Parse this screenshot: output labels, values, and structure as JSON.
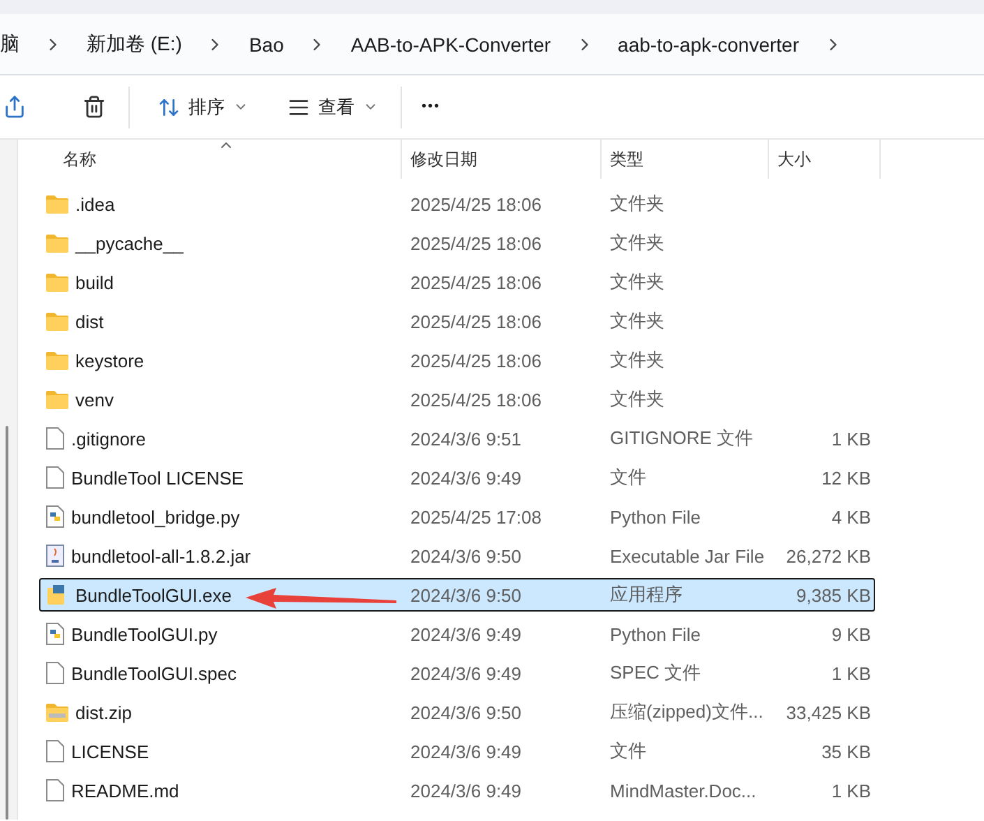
{
  "breadcrumbs": [
    "脑",
    "新加卷 (E:)",
    "Bao",
    "AAB-to-APK-Converter",
    "aab-to-apk-converter"
  ],
  "toolbar": {
    "sort": "排序",
    "view": "查看",
    "more": "•••"
  },
  "columns": [
    "名称",
    "修改日期",
    "类型",
    "大小"
  ],
  "rows": [
    {
      "kind": "folder",
      "name": ".idea",
      "date": "2025/4/25 18:06",
      "type": "文件夹",
      "size": "",
      "selected": false
    },
    {
      "kind": "folder",
      "name": "__pycache__",
      "date": "2025/4/25 18:06",
      "type": "文件夹",
      "size": "",
      "selected": false
    },
    {
      "kind": "folder",
      "name": "build",
      "date": "2025/4/25 18:06",
      "type": "文件夹",
      "size": "",
      "selected": false
    },
    {
      "kind": "folder",
      "name": "dist",
      "date": "2025/4/25 18:06",
      "type": "文件夹",
      "size": "",
      "selected": false
    },
    {
      "kind": "folder",
      "name": "keystore",
      "date": "2025/4/25 18:06",
      "type": "文件夹",
      "size": "",
      "selected": false
    },
    {
      "kind": "folder",
      "name": "venv",
      "date": "2025/4/25 18:06",
      "type": "文件夹",
      "size": "",
      "selected": false
    },
    {
      "kind": "file",
      "name": ".gitignore",
      "date": "2024/3/6 9:51",
      "type": "GITIGNORE 文件",
      "size": "1 KB",
      "selected": false
    },
    {
      "kind": "file",
      "name": "BundleTool LICENSE",
      "date": "2024/3/6 9:49",
      "type": "文件",
      "size": "12 KB",
      "selected": false
    },
    {
      "kind": "python",
      "name": "bundletool_bridge.py",
      "date": "2025/4/25 17:08",
      "type": "Python File",
      "size": "4 KB",
      "selected": false
    },
    {
      "kind": "jar",
      "name": "bundletool-all-1.8.2.jar",
      "date": "2024/3/6 9:50",
      "type": "Executable Jar File",
      "size": "26,272 KB",
      "selected": false
    },
    {
      "kind": "exe",
      "name": "BundleToolGUI.exe",
      "date": "2024/3/6 9:50",
      "type": "应用程序",
      "size": "9,385 KB",
      "selected": true
    },
    {
      "kind": "python",
      "name": "BundleToolGUI.py",
      "date": "2024/3/6 9:49",
      "type": "Python File",
      "size": "9 KB",
      "selected": false
    },
    {
      "kind": "file",
      "name": "BundleToolGUI.spec",
      "date": "2024/3/6 9:49",
      "type": "SPEC 文件",
      "size": "1 KB",
      "selected": false
    },
    {
      "kind": "zip",
      "name": "dist.zip",
      "date": "2024/3/6 9:50",
      "type": "压缩(zipped)文件...",
      "size": "33,425 KB",
      "selected": false
    },
    {
      "kind": "file",
      "name": "LICENSE",
      "date": "2024/3/6 9:49",
      "type": "文件",
      "size": "35 KB",
      "selected": false
    },
    {
      "kind": "file",
      "name": "README.md",
      "date": "2024/3/6 9:49",
      "type": "MindMaster.Doc...",
      "size": "1 KB",
      "selected": false
    }
  ]
}
